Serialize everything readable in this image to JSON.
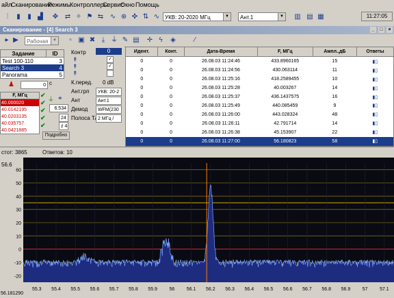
{
  "menu": [
    "айл",
    "Сканирование",
    "Режимы",
    "Контроллеры",
    "Сервис",
    "Окно",
    "Помощь"
  ],
  "toolbar": {
    "band_combo": "УКВ: 20-2020 МГц",
    "ant_combo": "Ант.1",
    "clock": "11:27:05"
  },
  "window_title": "Сканирование - [4] Search 3",
  "subtool": {
    "mode_combo": "Рабочая"
  },
  "tasks": {
    "headers": [
      "Задание",
      "ID"
    ],
    "rows": [
      {
        "name": "Test 100-110",
        "id": "3"
      },
      {
        "name": "Search 3",
        "id": "4"
      },
      {
        "name": "Panorama",
        "id": "5"
      }
    ]
  },
  "controls": {
    "kontr_label": "Контр",
    "kontr_value": "0",
    "kperedd_label": "К.перед.",
    "kperedd_value": "0 dB",
    "antgrp_label": "Ант.грп",
    "antgrp_value": "УКВ: 20-2",
    "ant_label": "Ант",
    "ant_value": "Ант.1",
    "demod_label": "Демод",
    "demod_value": "WFM(230",
    "polosa_label": "Полоса ТА",
    "polosa_value": "2 МГц /",
    "time_field": "0",
    "time_unit": "с",
    "field_6534": "6.534",
    "field_24": "24",
    "field_z4": "z 4",
    "podrobno": "Подробно"
  },
  "freqlist": {
    "header": "F, МГц",
    "items": [
      "40.000020",
      "40.0142195",
      "40.0203135",
      "40.035757",
      "40.0421885"
    ]
  },
  "grid": {
    "headers": [
      "Идент.",
      "Конт.",
      "Дата-Время",
      "F, МГц",
      "Ампл.,дБ",
      "Ответы"
    ],
    "rows": [
      {
        "id": "0",
        "kont": "0",
        "dt": "26.08.03  11:24:46",
        "f": "433.8960165",
        "a": "15"
      },
      {
        "id": "0",
        "kont": "0",
        "dt": "26.08.03  11:24:56",
        "f": "430.063114",
        "a": "11"
      },
      {
        "id": "0",
        "kont": "0",
        "dt": "26.08.03  11:25:16",
        "f": "418.2589455",
        "a": "10"
      },
      {
        "id": "0",
        "kont": "0",
        "dt": "26.08.03  11:25:28",
        "f": "40.003267",
        "a": "14"
      },
      {
        "id": "0",
        "kont": "0",
        "dt": "26.08.03  11:25:37",
        "f": "436.1437575",
        "a": "16"
      },
      {
        "id": "0",
        "kont": "0",
        "dt": "26.08.03  11:25:49",
        "f": "440.085459",
        "a": "9"
      },
      {
        "id": "0",
        "kont": "0",
        "dt": "26.08.03  11:26:00",
        "f": "443.028324",
        "a": "48"
      },
      {
        "id": "0",
        "kont": "0",
        "dt": "26.08.03  11:26:11",
        "f": "42.791714",
        "a": "14"
      },
      {
        "id": "0",
        "kont": "0",
        "dt": "26.08.03  11:26:38",
        "f": "45.153907",
        "a": "22"
      },
      {
        "id": "0",
        "kont": "0",
        "dt": "26.08.03  11:27:00",
        "f": "56.180823",
        "a": "58"
      }
    ]
  },
  "status": {
    "left": "стот: 3865",
    "mid": "Ответов: 10"
  },
  "spectrum": {
    "top_label": "56.6",
    "bottom_left": "56.181290",
    "y_ticks": [
      "60",
      "50",
      "40",
      "30",
      "20",
      "10",
      "0",
      "-10",
      "-20"
    ],
    "x_ticks": [
      "55.3",
      "55.4",
      "55.5",
      "55.6",
      "55.7",
      "55.8",
      "55.9",
      "56",
      "56.1",
      "56.2",
      "56.3",
      "56.4",
      "56.5",
      "56.6",
      "56.7",
      "56.8",
      "56.9",
      "57",
      "57.1"
    ],
    "marker_freq": 56.18,
    "peak_freq": 56.2,
    "colors": {
      "trace": "#7fa8ff",
      "fill": "#1e2c80",
      "marker": "#ff7a00",
      "grid_h": "#c9b000",
      "bg": "#0a0a12"
    }
  }
}
